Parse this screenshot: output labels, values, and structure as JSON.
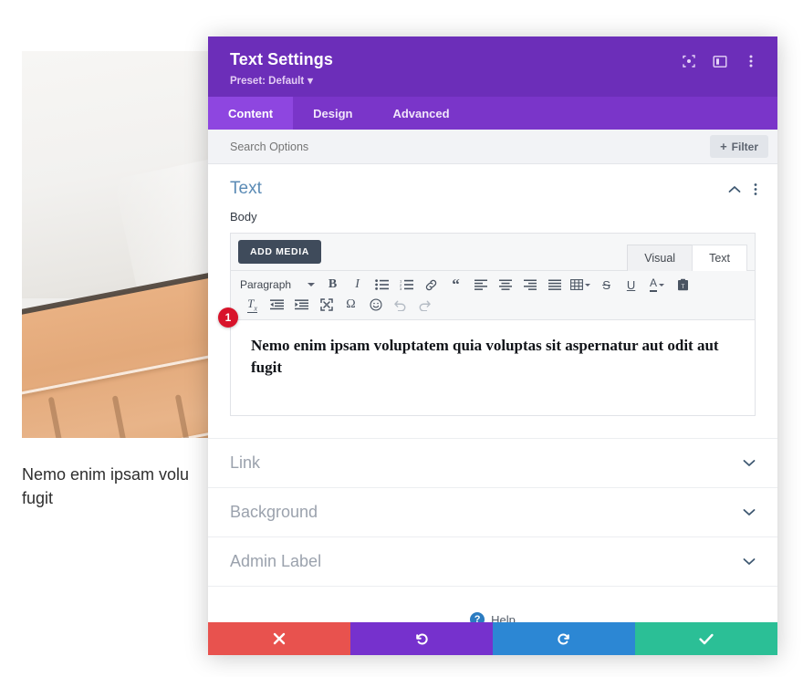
{
  "background_page": {
    "hero_image_name": "wood-planks-photo",
    "paragraph": "Nemo enim ipsam volu\nfugit"
  },
  "modal": {
    "title": "Text Settings",
    "preset": "Preset: Default",
    "preset_caret": "▾",
    "header_icons": [
      {
        "name": "focus-target-icon"
      },
      {
        "name": "split-view-icon"
      },
      {
        "name": "overflow-menu-icon"
      }
    ],
    "tabs": [
      {
        "label": "Content",
        "active": true
      },
      {
        "label": "Design",
        "active": false
      },
      {
        "label": "Advanced",
        "active": false
      }
    ],
    "search": {
      "placeholder": "Search Options",
      "value": ""
    },
    "filter_button": {
      "label": "Filter",
      "plus": "+"
    },
    "section": {
      "title": "Text",
      "collapse_icon": "chevron-up-icon",
      "menu_icon": "overflow-menu-icon"
    },
    "body_field": {
      "label": "Body",
      "add_media_label": "ADD MEDIA",
      "mode_tabs": [
        {
          "label": "Visual",
          "active": true
        },
        {
          "label": "Text",
          "active": false
        }
      ],
      "format_select": "Paragraph",
      "toolbar_row1": [
        "bold-icon",
        "italic-icon",
        "bulleted-list-icon",
        "numbered-list-icon",
        "link-icon",
        "blockquote-icon",
        "align-left-icon",
        "align-center-icon",
        "align-right-icon",
        "align-justify-icon",
        "table-icon",
        "strikethrough-icon",
        "underline-icon",
        "text-color-icon",
        "paste-as-text-icon"
      ],
      "toolbar_row2": [
        "clear-formatting-icon",
        "outdent-icon",
        "indent-icon",
        "fullscreen-icon",
        "special-character-icon",
        "emoji-icon",
        "undo-icon",
        "redo-icon"
      ],
      "content": "Nemo enim ipsam voluptatem quia voluptas sit aspernatur aut odit aut fugit",
      "marker": "1"
    },
    "collapsed_sections": [
      {
        "label": "Link"
      },
      {
        "label": "Background"
      },
      {
        "label": "Admin Label"
      }
    ],
    "help": {
      "label": "Help",
      "icon_glyph": "?"
    },
    "footer_buttons": [
      {
        "name": "cancel-button",
        "icon": "close-icon",
        "color": "#e8524e"
      },
      {
        "name": "undo-button",
        "icon": "undo-icon",
        "color": "#7631cd"
      },
      {
        "name": "redo-button",
        "icon": "redo-icon",
        "color": "#2c87d4"
      },
      {
        "name": "save-button",
        "icon": "check-icon",
        "color": "#2bbf96"
      }
    ]
  },
  "colors": {
    "header_purple": "#6c2eb9",
    "tabbar_purple": "#7a35c9",
    "tab_active_purple": "#8e46e0",
    "section_title_blue": "#5b8bb5",
    "marker_red": "#d8132a",
    "help_blue": "#2b7cc1"
  }
}
